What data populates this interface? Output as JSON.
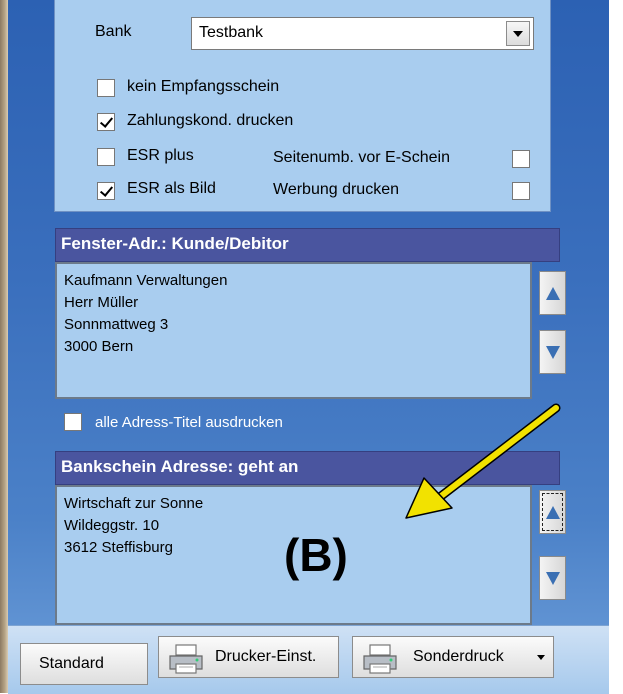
{
  "options_panel": {
    "bank_label": "Bank",
    "bank_value": "Testbank",
    "kein_empfangsschein": {
      "label": "kein Empfangsschein",
      "checked": false
    },
    "zahlungskond_drucken": {
      "label": "Zahlungskond. drucken",
      "checked": true
    },
    "esr_plus": {
      "label": "ESR plus",
      "checked": false
    },
    "seitenumb": {
      "label": "Seitenumb. vor E-Schein",
      "checked": false
    },
    "esr_als_bild": {
      "label": "ESR als Bild",
      "checked": true
    },
    "werbung_drucken": {
      "label": "Werbung drucken",
      "checked": false
    }
  },
  "fenster_adr": {
    "title": "Fenster-Adr.: Kunde/Debitor",
    "lines": [
      "Kaufmann Verwaltungen",
      "Herr Müller",
      "Sonnmattweg 3",
      "3000 Bern"
    ]
  },
  "alle_adress_titel": {
    "label": "alle Adress-Titel ausdrucken",
    "checked": false
  },
  "bankschein": {
    "title": "Bankschein Adresse: geht an",
    "lines": [
      "Wirtschaft zur Sonne",
      "Wildeggstr. 10",
      "3612 Steffisburg"
    ]
  },
  "annotation": {
    "label": "(B)",
    "arrow_color": "#f2e200"
  },
  "footer": {
    "standard_label": "Standard",
    "drucker_label": "Drucker-Einst.",
    "sonderdruck_label": "Sonderdruck",
    "printer_icon": "printer-icon"
  },
  "colors": {
    "header_bg": "#4a559f",
    "panel_bg": "#a9cdef",
    "background": "#2c61b3"
  }
}
